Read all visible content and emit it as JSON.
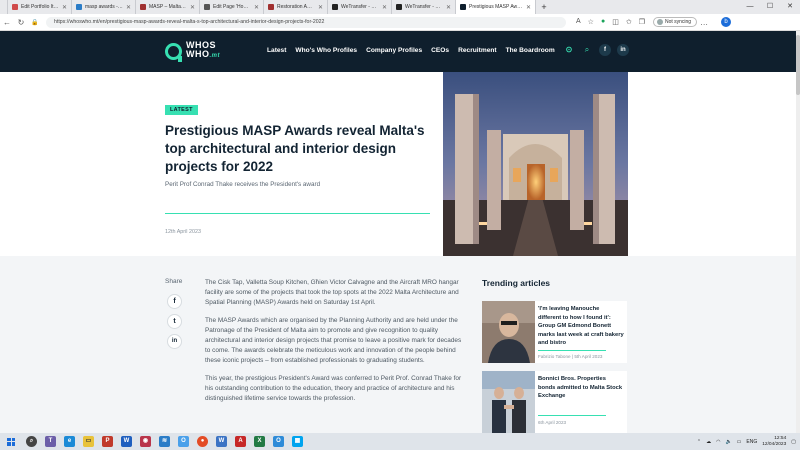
{
  "browser": {
    "tabs": [
      {
        "title": "Edit Portfolio Item 'Public'",
        "color": "#d04a4a"
      },
      {
        "title": "masp awards - Search",
        "color": "#2a7cc7"
      },
      {
        "title": "MASP – Malta Architecture",
        "color": "#a03030"
      },
      {
        "title": "Edit Page 'Home' ‹ MASP",
        "color": "#555555"
      },
      {
        "title": "Restoration Award – MASP",
        "color": "#a03030"
      },
      {
        "title": "WeTransfer - Send Large F",
        "color": "#222222"
      },
      {
        "title": "WeTransfer - Send Large F",
        "color": "#222222"
      },
      {
        "title": "Prestigious MASP Awards",
        "color": "#0f1f2d",
        "active": true
      }
    ],
    "url": "https://whoswho.mt/en/prestigious-masp-awards-reveal-malta-s-top-architectural-and-interior-design-projects-for-2022",
    "sync_label": "Not syncing"
  },
  "site": {
    "logo_top": "WHOS",
    "logo_bottom": "WHO",
    "logo_suffix": ".mt",
    "nav": [
      "Latest",
      "Who's Who Profiles",
      "Company Profiles",
      "CEOs",
      "Recruitment",
      "The Boardroom"
    ],
    "accent": "#37e0b2",
    "header_bg": "#0f1f2d"
  },
  "article": {
    "badge": "LATEST",
    "headline": "Prestigious MASP Awards reveal Malta's top architectural and interior design projects for 2022",
    "subhead": "Perit Prof Conrad Thake receives the President's award",
    "date": "12th April 2023",
    "share_label": "Share",
    "share_icons": [
      "f",
      "t",
      "in"
    ],
    "paragraphs": [
      "The Cisk Tap, Valletta Soup Kitchen, Għien Victor Calvagne and the Aircraft MRO hangar facility are some of the projects that took the top spots at the 2022 Malta Architecture and Spatial Planning (MASP) Awards held on Saturday 1st April.",
      "The MASP Awards which are organised by the Planning Authority and are held under the Patronage of the President of Malta aim to promote and give recognition to quality architectural and interior design projects that promise to leave a positive mark for decades to come. The awards celebrate the meticulous work and innovation of the people behind these iconic projects – from established professionals to graduating students.",
      "This year, the prestigious President's Award was conferred to Perit Prof. Conrad Thake for his outstanding contribution to the education, theory and practice of architecture and his distinguished lifetime service towards the profession."
    ]
  },
  "trending": {
    "title": "Trending articles",
    "items": [
      {
        "title": "'I'm leaving Manouche different to how I found it': Group GM Edmond Bonett marks last week at craft bakery and bistro",
        "meta": "Fabrizio Tabone | 5th April 2023"
      },
      {
        "title": "Bonnici Bros. Properties bonds admitted to Malta Stock Exchange",
        "meta": "6th April 2023"
      }
    ]
  },
  "taskbar": {
    "lang": "ENG",
    "time": "12:54",
    "date": "12/04/2023"
  }
}
